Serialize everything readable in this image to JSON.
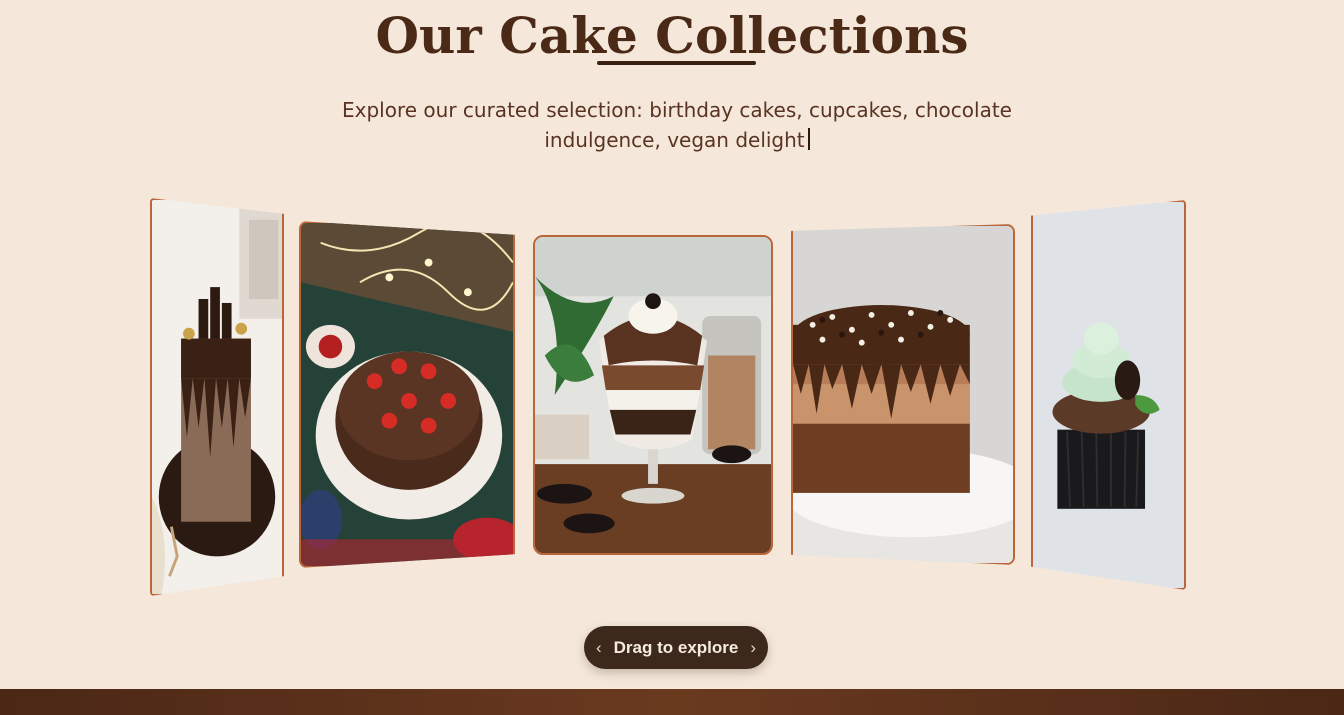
{
  "header": {
    "title": "Our Cake Collections",
    "subtitle": "Explore our curated selection: birthday cakes, cupcakes, chocolate indulgence, vegan delight"
  },
  "gallery": {
    "cards": [
      {
        "name": "chocolate-drip-tower-cake",
        "icon": "cake-image"
      },
      {
        "name": "strawberry-chocolate-cake",
        "icon": "cake-image"
      },
      {
        "name": "oreo-chocolate-parfait",
        "icon": "dessert-image"
      },
      {
        "name": "sprinkle-mousse-cake",
        "icon": "cake-image"
      },
      {
        "name": "mint-cupcake",
        "icon": "cupcake-image"
      }
    ]
  },
  "controls": {
    "explore_label": "Drag to explore",
    "prev_icon": "chevron-left-icon",
    "next_icon": "chevron-right-icon"
  },
  "colors": {
    "background": "#f5e8db",
    "title": "#4a2a17",
    "accent_border": "#b9673a",
    "pill": "#3d281c",
    "footer": "#5a2f1a"
  }
}
